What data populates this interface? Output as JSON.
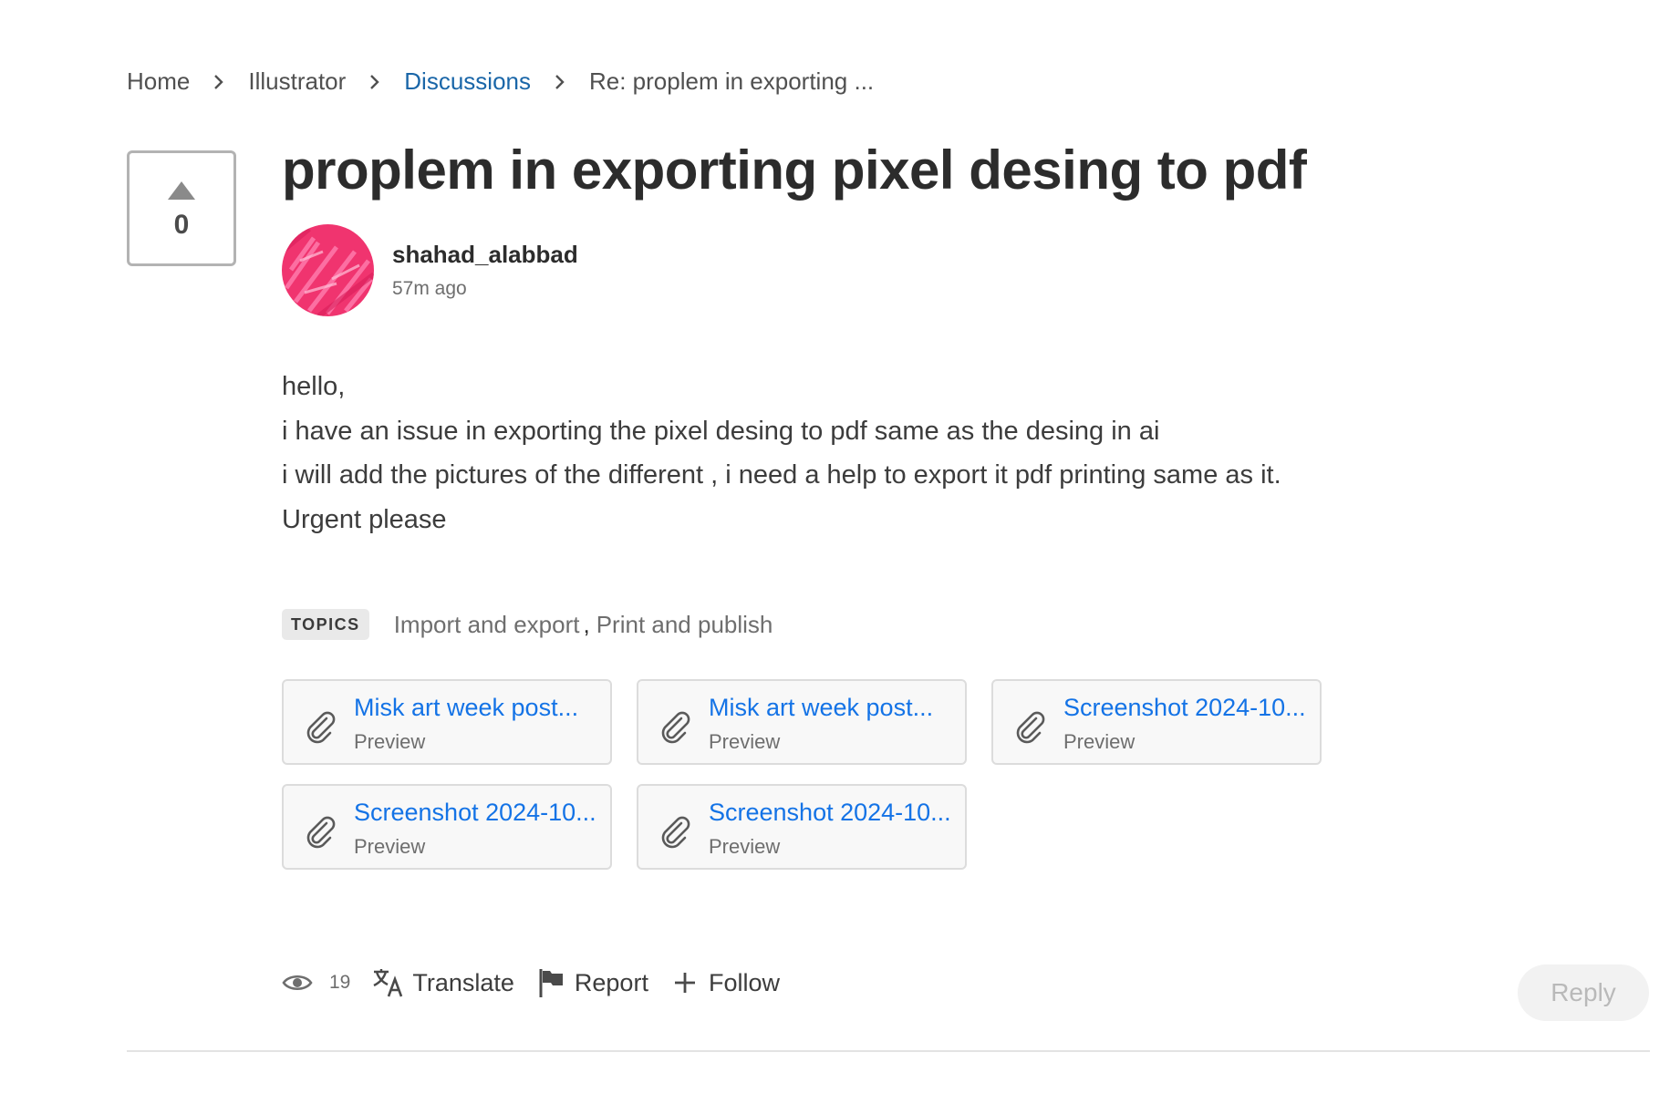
{
  "breadcrumb": {
    "items": [
      {
        "label": "Home"
      },
      {
        "label": "Illustrator"
      },
      {
        "label": "Discussions"
      },
      {
        "label": "Re: proplem in exporting ..."
      }
    ]
  },
  "vote": {
    "count": "0"
  },
  "post": {
    "title": "proplem in exporting pixel desing to pdf",
    "author": "shahad_alabbad",
    "time": "57m ago",
    "body": [
      "hello,",
      "i have an issue in exporting the pixel desing to pdf same as the desing in ai",
      "i will add the pictures of the different , i need a help to export it pdf printing same as it.",
      "Urgent please"
    ]
  },
  "topics": {
    "tag": "TOPICS",
    "items": [
      "Import and export",
      "Print and publish"
    ],
    "separator": ","
  },
  "attachments": [
    {
      "name": "Misk art week post...",
      "preview": "Preview"
    },
    {
      "name": "Misk art week post...",
      "preview": "Preview"
    },
    {
      "name": "Screenshot 2024-10...",
      "preview": "Preview"
    },
    {
      "name": "Screenshot 2024-10...",
      "preview": "Preview"
    },
    {
      "name": "Screenshot 2024-10...",
      "preview": "Preview"
    }
  ],
  "footer": {
    "views": "19",
    "translate_label": "Translate",
    "report_label": "Report",
    "follow_label": "Follow",
    "reply_label": "Reply"
  },
  "colors": {
    "link_blue": "#1473e6",
    "breadcrumb_link": "#1a66a8",
    "avatar_pink": "#f0346f"
  },
  "icons": [
    "chevron-right-icon",
    "triangle-up-icon",
    "paperclip-icon",
    "eye-icon",
    "translate-icon",
    "flag-icon",
    "plus-icon"
  ]
}
